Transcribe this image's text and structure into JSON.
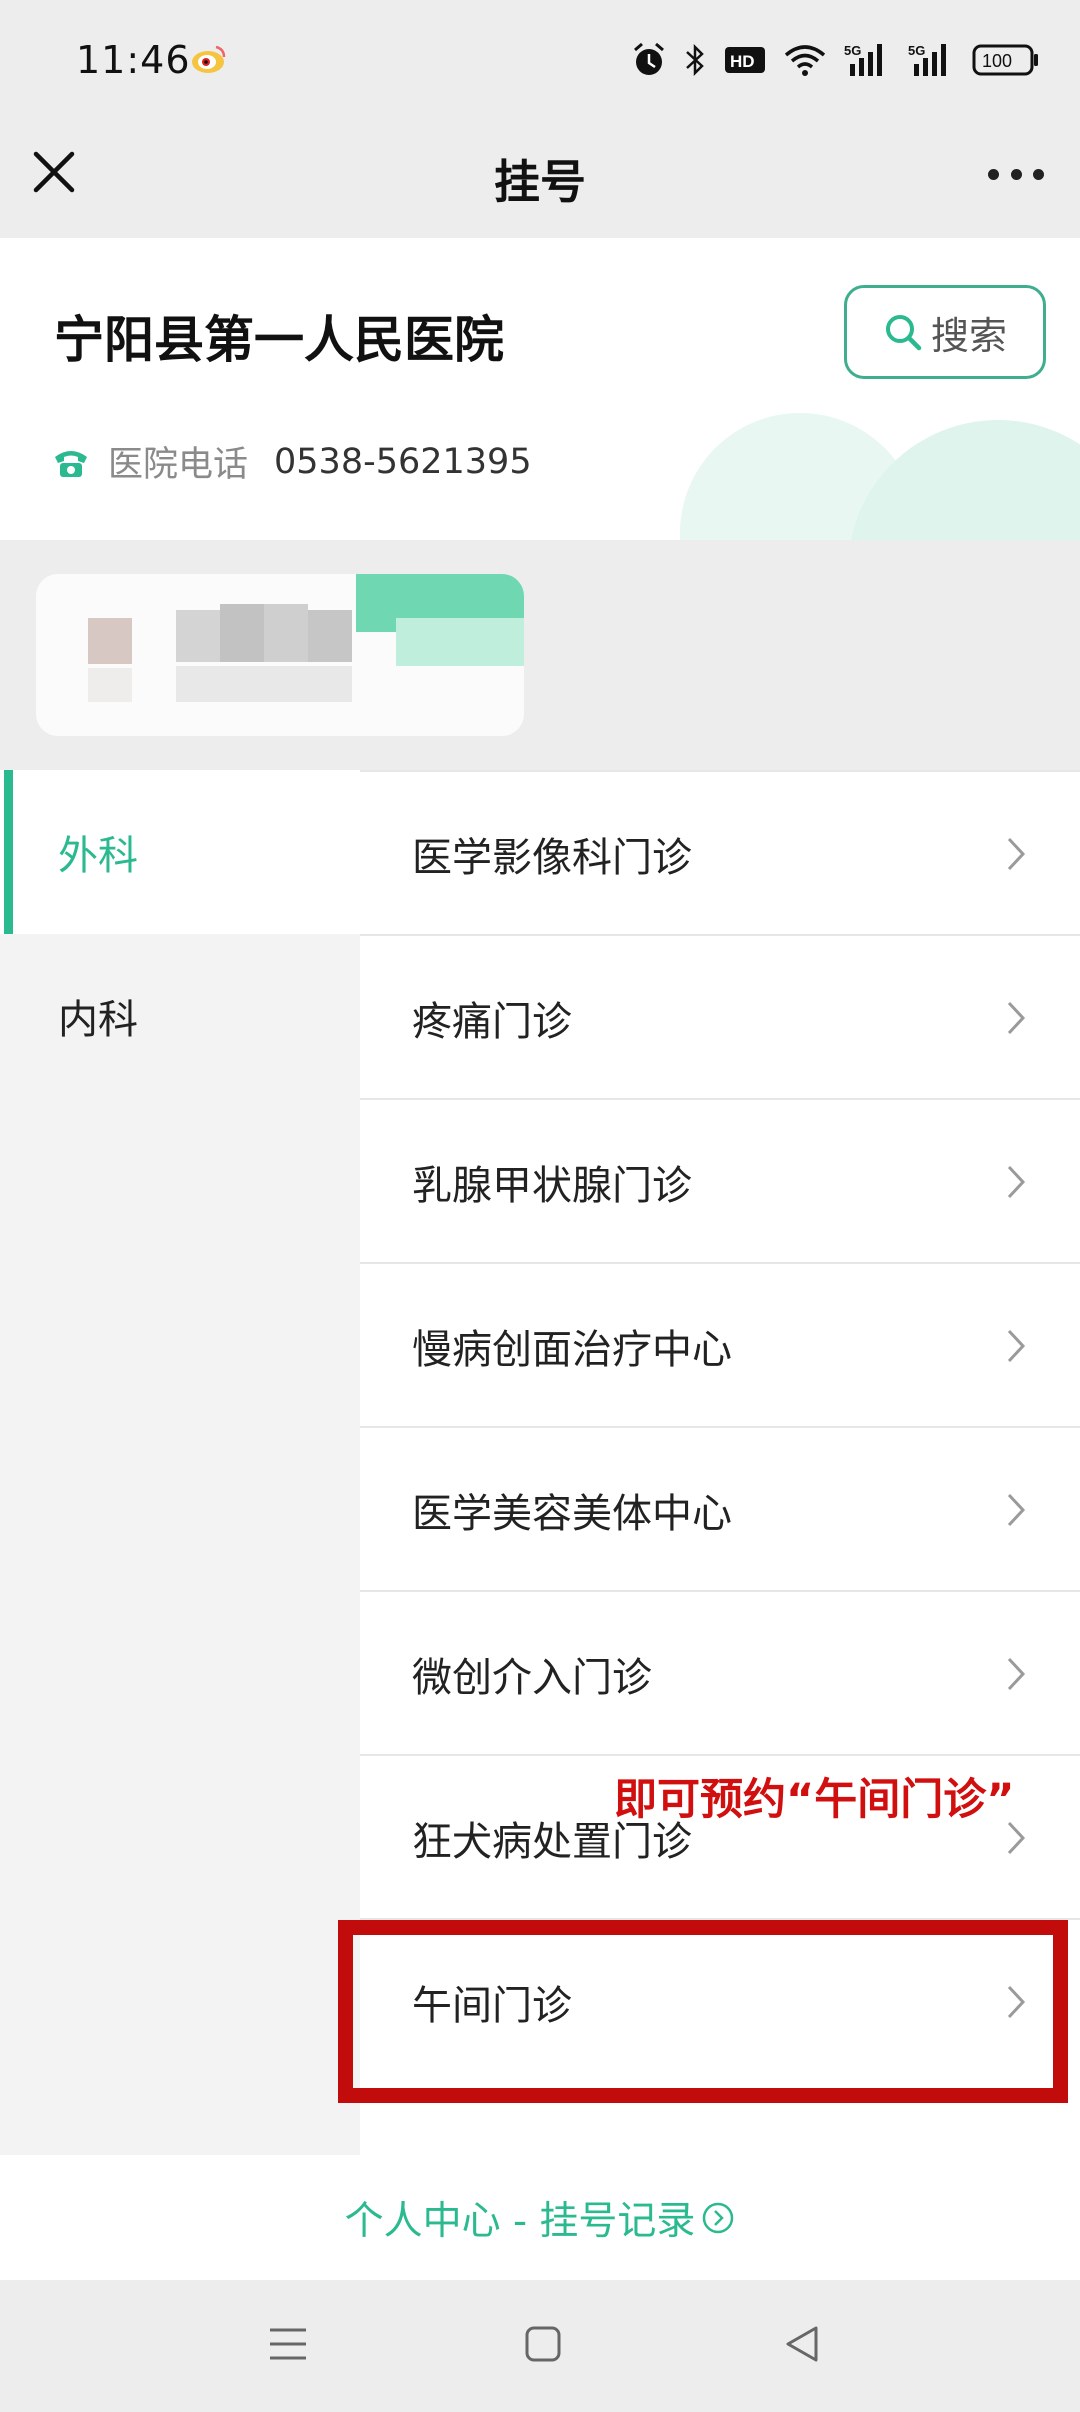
{
  "status_bar": {
    "time": "11:46",
    "battery": "100",
    "icons": [
      "weibo-icon",
      "alarm-icon",
      "bluetooth-icon",
      "hd-icon",
      "wifi-icon",
      "signal-5g-icon",
      "signal-5g-icon",
      "battery-icon"
    ]
  },
  "nav": {
    "title": "挂号"
  },
  "hospital": {
    "name": "宁阳县第一人民医院",
    "search_label": "搜索",
    "phone_label": "医院电话",
    "phone_number": "0538-5621395"
  },
  "sidebar": {
    "items": [
      {
        "label": "外科",
        "active": true
      },
      {
        "label": "内科",
        "active": false
      }
    ]
  },
  "departments": [
    {
      "label": "医学影像科门诊"
    },
    {
      "label": "疼痛门诊"
    },
    {
      "label": "乳腺甲状腺门诊"
    },
    {
      "label": "慢病创面治疗中心"
    },
    {
      "label": "医学美容美体中心"
    },
    {
      "label": "微创介入门诊"
    },
    {
      "label": "狂犬病处置门诊"
    },
    {
      "label": "午间门诊"
    }
  ],
  "annotation": {
    "text": "即可预约“午间门诊”",
    "color": "#d10f0f"
  },
  "footer": {
    "link_label": "个人中心 - 挂号记录"
  },
  "colors": {
    "accent": "#2bb98f",
    "highlight_box": "#c20b0b"
  }
}
